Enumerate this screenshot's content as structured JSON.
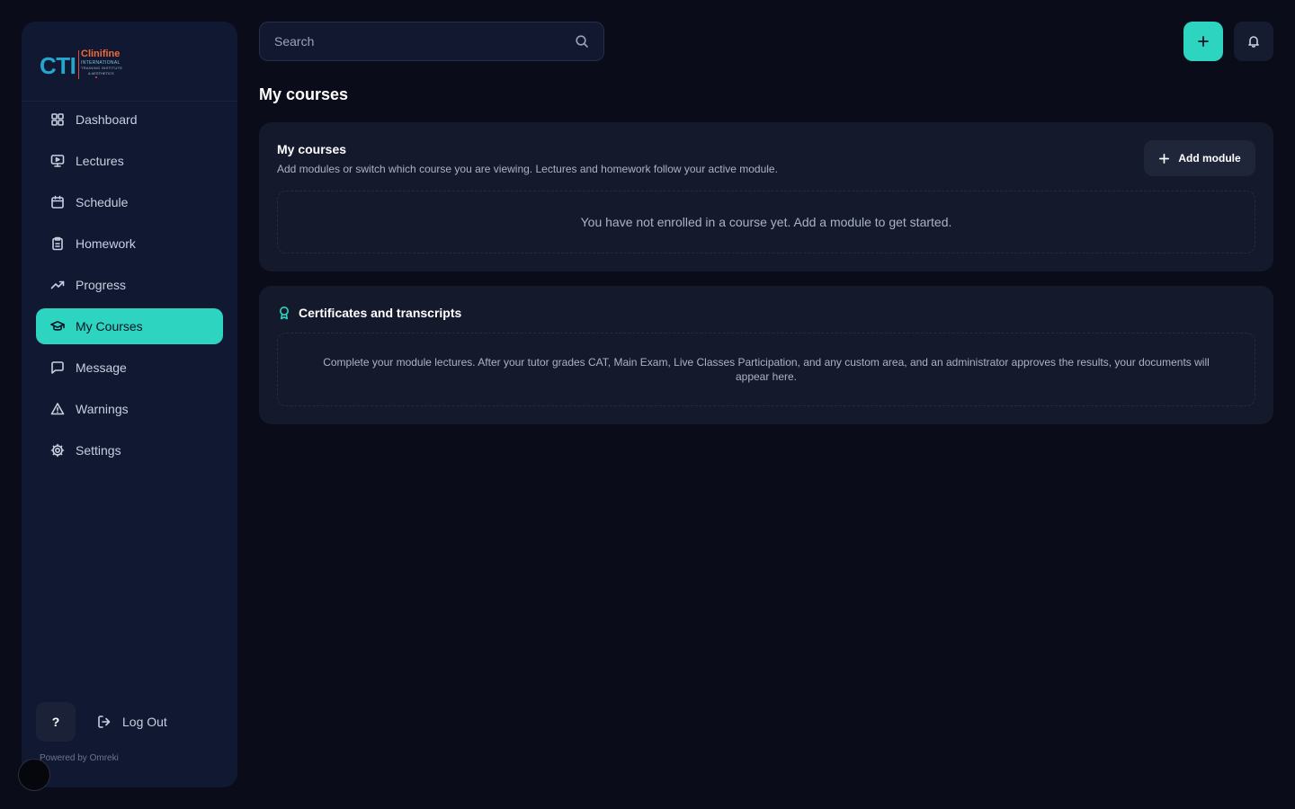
{
  "brand": {
    "logo_mark": "CTI",
    "logo_name": "Clinifine",
    "logo_line1": "INTERNATIONAL",
    "logo_line2": "TRAINING INSTITUTE",
    "logo_line3": "& AESTHETICS",
    "accent_color": "#2dd4bf"
  },
  "sidebar": {
    "items": [
      {
        "label": "Dashboard",
        "icon": "grid-icon"
      },
      {
        "label": "Lectures",
        "icon": "monitor-play-icon"
      },
      {
        "label": "Schedule",
        "icon": "calendar-icon"
      },
      {
        "label": "Homework",
        "icon": "clipboard-icon"
      },
      {
        "label": "Progress",
        "icon": "trending-up-icon"
      },
      {
        "label": "My Courses",
        "icon": "graduation-cap-icon",
        "active": true
      },
      {
        "label": "Message",
        "icon": "message-square-icon"
      },
      {
        "label": "Warnings",
        "icon": "alert-triangle-icon"
      },
      {
        "label": "Settings",
        "icon": "gear-icon"
      }
    ],
    "help_label": "?",
    "logout_label": "Log Out",
    "powered_by": "Powered by Omreki"
  },
  "header": {
    "search_placeholder": "Search"
  },
  "page": {
    "title": "My courses"
  },
  "courses_card": {
    "title": "My courses",
    "subtitle": "Add modules or switch which course you are viewing. Lectures and homework follow your active module.",
    "add_button": "Add module",
    "empty_message": "You have not enrolled in a course yet. Add a module to get started."
  },
  "certificates_card": {
    "title": "Certificates and transcripts",
    "empty_message": "Complete your module lectures. After your tutor grades CAT, Main Exam, Live Classes Participation, and any custom area, and an administrator approves the results, your documents will appear here."
  }
}
